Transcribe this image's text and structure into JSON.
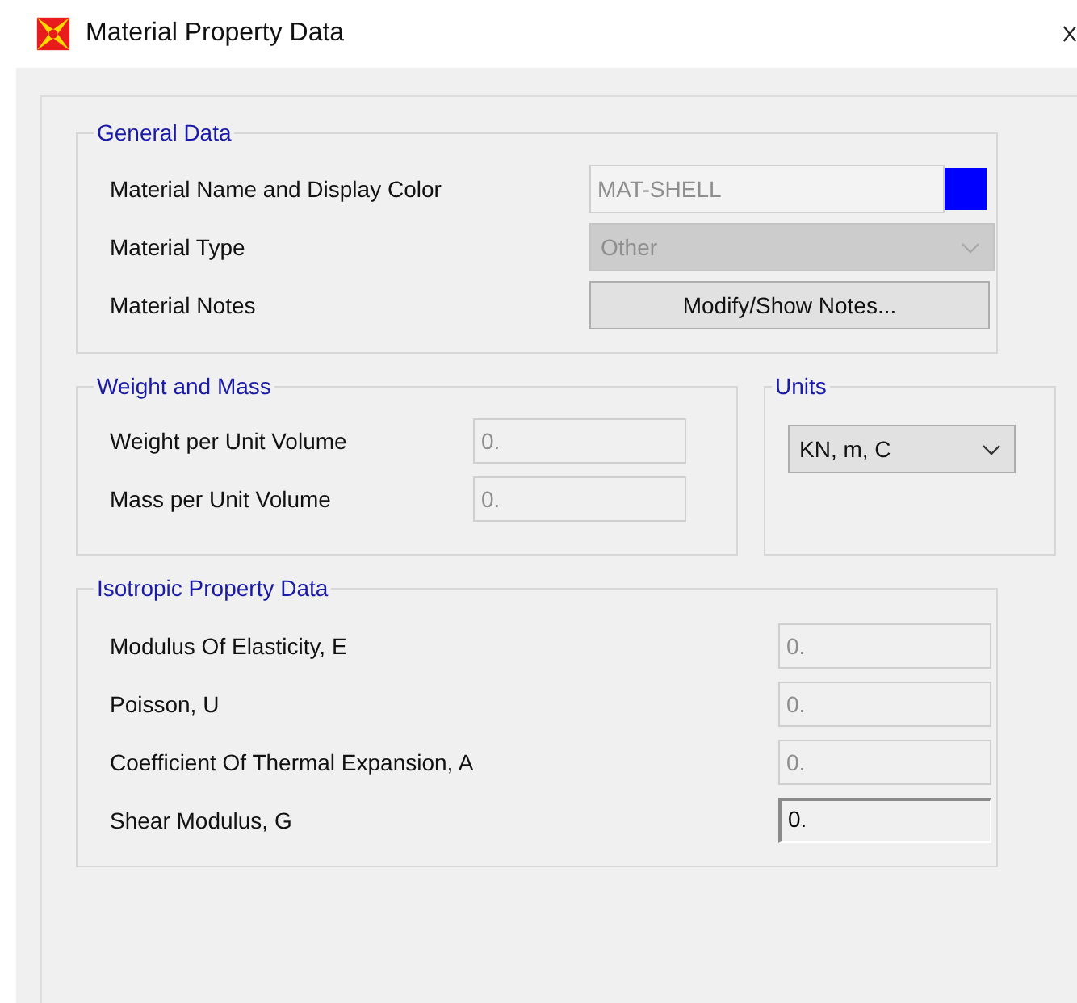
{
  "window": {
    "title": "Material Property Data"
  },
  "general_data": {
    "legend": "General Data",
    "name": {
      "label": "Material Name and Display Color",
      "value": "MAT-SHELL",
      "disabled": true,
      "color": "#0000ff"
    },
    "type": {
      "label": "Material Type",
      "value": "Other",
      "disabled": true
    },
    "notes": {
      "label": "Material Notes",
      "button": "Modify/Show Notes..."
    }
  },
  "weight_and_mass": {
    "legend": "Weight and Mass",
    "fields": [
      {
        "label": "Weight per Unit Volume",
        "value": "0.",
        "disabled": true
      },
      {
        "label": "Mass per Unit Volume",
        "value": "0.",
        "disabled": true
      }
    ]
  },
  "units": {
    "legend": "Units",
    "value": "KN, m, C"
  },
  "isotropic_property_data": {
    "legend": "Isotropic Property Data",
    "fields": [
      {
        "label": "Modulus Of Elasticity,  E",
        "value": "0.",
        "disabled": true
      },
      {
        "label": "Poisson, U",
        "value": "0.",
        "disabled": true
      },
      {
        "label": "Coefficient Of Thermal Expansion,  A",
        "value": "0.",
        "disabled": true
      },
      {
        "label": "Shear Modulus,  G",
        "value": "0.",
        "disabled": false
      }
    ]
  }
}
